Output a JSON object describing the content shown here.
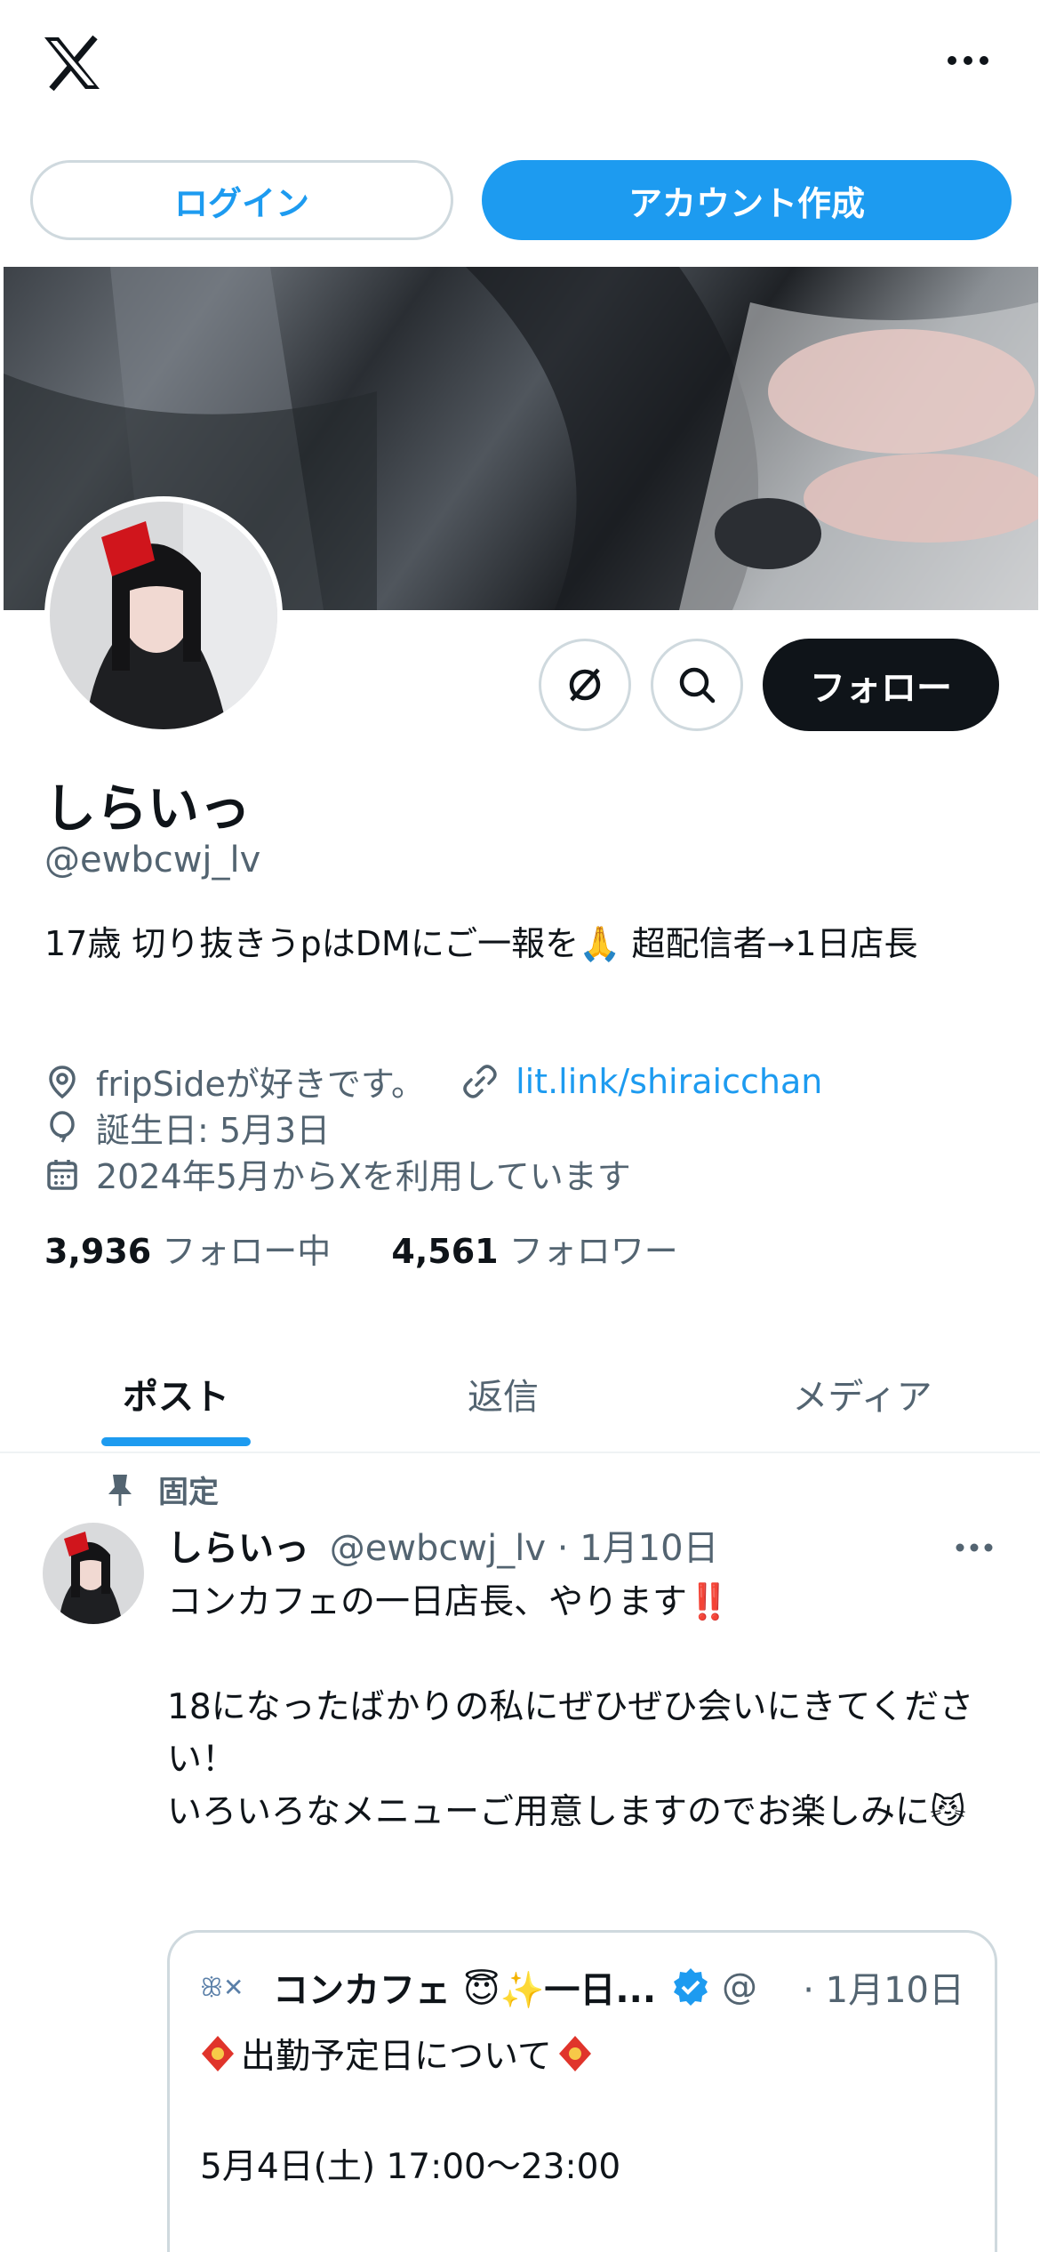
{
  "topbar": {
    "logo": "x-logo-icon",
    "more": "more-horizontal-icon"
  },
  "auth": {
    "login_label": "ログイン",
    "signup_label": "アカウント作成"
  },
  "profile": {
    "display_name": "しらいっ",
    "handle": "@ewbcwj_lv",
    "bio": "17歳 切り抜きうpはDMにご一報を🙏 超配信者→1日店長",
    "location": "fripSideが好きです。",
    "link": "lit.link/shiraicchan",
    "birthday": "誕生日: 5月3日",
    "joined": "2024年5月からXを利用しています",
    "following_count": "3,936",
    "following_label": "フォロー中",
    "followers_count": "4,561",
    "followers_label": "フォロワー",
    "follow_label": "フォロー"
  },
  "tabs": [
    {
      "label": "ポスト",
      "active": true
    },
    {
      "label": "返信",
      "active": false
    },
    {
      "label": "メディア",
      "active": false
    }
  ],
  "post": {
    "pinned_label": "固定",
    "author": "しらいっ",
    "handle": "@ewbcwj_lv",
    "separator": "·",
    "date": "1月10日",
    "text": "コンカフェの一日店長、やります‼️\n\n18になったばかりの私にぜひぜひ会いにきてください！\nいろいろなメニューご用意しますのでお楽しみに😼",
    "quote": {
      "author": "コンカフェ 😇✨一日...",
      "handle": "@",
      "date": "· 1月10日",
      "line1": "出勤予定日について",
      "line2": "5月4日(土) 17:00〜23:00"
    }
  },
  "colors": {
    "accent": "#1d9bf0",
    "text": "#0f1419",
    "muted": "#536471",
    "border": "#cfd9de"
  }
}
